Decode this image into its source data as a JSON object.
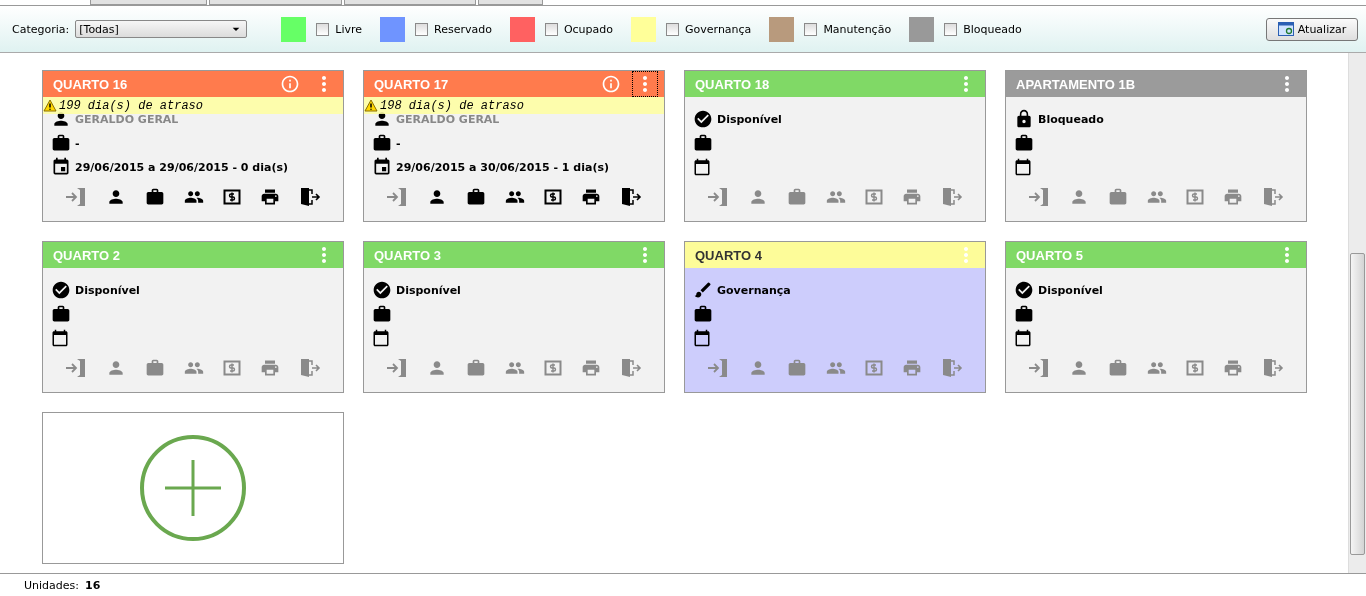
{
  "toolbar": {
    "category_label": "Categoria:",
    "category_value": "[Todas]",
    "legend": [
      {
        "label": "Livre",
        "color": "#66ff66",
        "checked": false
      },
      {
        "label": "Reservado",
        "color": "#6f94ff",
        "checked": false
      },
      {
        "label": "Ocupado",
        "color": "#ff6161",
        "checked": false
      },
      {
        "label": "Governança",
        "color": "#ffff99",
        "checked": false
      },
      {
        "label": "Manutenção",
        "color": "#b89a7d",
        "checked": false
      },
      {
        "label": "Bloqueado",
        "color": "#999999",
        "checked": false
      }
    ],
    "refresh_button": "Atualizar"
  },
  "rooms": [
    {
      "title": "QUARTO 16",
      "color": "#ff7b4d",
      "highlighted": false,
      "info": true,
      "menu_focused": false,
      "alert": "199 dia(s) de atraso",
      "actions_enabled": true,
      "lines": [
        {
          "kind": "guest",
          "text": "GERALDO GERAL"
        },
        {
          "kind": "bag",
          "text": "-"
        },
        {
          "kind": "dates",
          "text": "29/06/2015 a 29/06/2015 - 0 dia(s)"
        }
      ]
    },
    {
      "title": "QUARTO 17",
      "color": "#ff7b4d",
      "highlighted": false,
      "info": true,
      "menu_focused": true,
      "alert": "198 dia(s) de atraso",
      "actions_enabled": true,
      "lines": [
        {
          "kind": "guest",
          "text": "GERALDO GERAL"
        },
        {
          "kind": "bag",
          "text": "-"
        },
        {
          "kind": "dates",
          "text": "29/06/2015 a 30/06/2015 - 1 dia(s)"
        }
      ]
    },
    {
      "title": "QUARTO 18",
      "color": "#80d966",
      "highlighted": false,
      "info": false,
      "menu_focused": false,
      "actions_enabled": false,
      "lines": [
        {
          "kind": "available",
          "text": "Disponível"
        },
        {
          "kind": "bag"
        },
        {
          "kind": "calendar"
        }
      ]
    },
    {
      "title": "APARTAMENTO 1B",
      "color": "#9b9b9b",
      "highlighted": false,
      "info": false,
      "menu_focused": false,
      "actions_enabled": false,
      "lines": [
        {
          "kind": "blocked",
          "text": "Bloqueado"
        },
        {
          "kind": "bag"
        },
        {
          "kind": "calendar"
        }
      ]
    },
    {
      "title": "QUARTO 2",
      "color": "#80d966",
      "highlighted": false,
      "info": false,
      "menu_focused": false,
      "actions_enabled": false,
      "lines": [
        {
          "kind": "available",
          "text": "Disponível"
        },
        {
          "kind": "bag"
        },
        {
          "kind": "calendar"
        }
      ]
    },
    {
      "title": "QUARTO 3",
      "color": "#80d966",
      "highlighted": false,
      "info": false,
      "menu_focused": false,
      "actions_enabled": false,
      "lines": [
        {
          "kind": "available",
          "text": "Disponível"
        },
        {
          "kind": "bag"
        },
        {
          "kind": "calendar"
        }
      ]
    },
    {
      "title": "QUARTO 4",
      "color": "#fdfc99",
      "highlighted": true,
      "info": false,
      "menu_focused": false,
      "actions_enabled": false,
      "lines": [
        {
          "kind": "cleaning",
          "text": "Governança"
        },
        {
          "kind": "bag"
        },
        {
          "kind": "calendar"
        }
      ]
    },
    {
      "title": "QUARTO 5",
      "color": "#80d966",
      "highlighted": false,
      "info": false,
      "menu_focused": false,
      "actions_enabled": false,
      "lines": [
        {
          "kind": "available",
          "text": "Disponível"
        },
        {
          "kind": "bag"
        },
        {
          "kind": "calendar"
        }
      ]
    }
  ],
  "status_bar": {
    "label": "Unidades:",
    "value": "16"
  }
}
